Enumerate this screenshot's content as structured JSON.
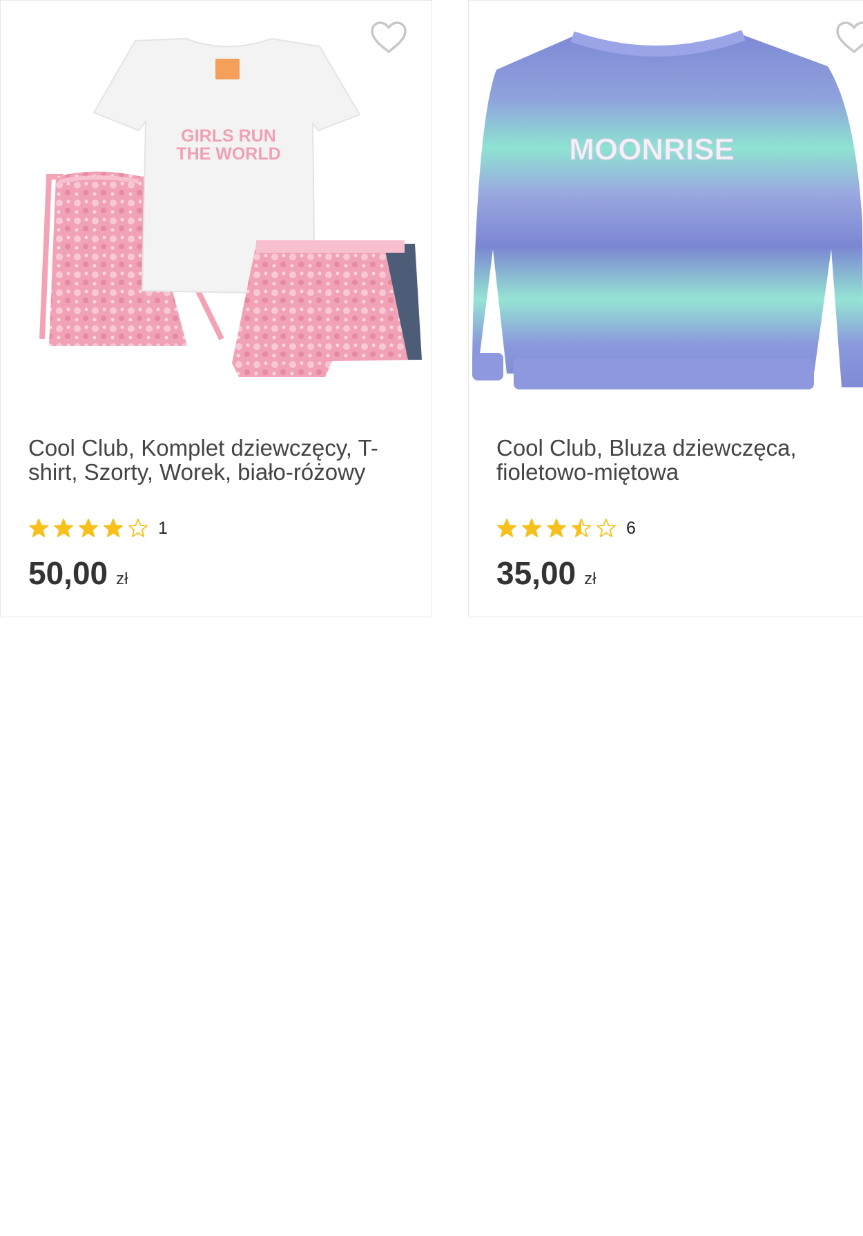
{
  "colors": {
    "star": "#f7c01b",
    "star_outline": "#999999",
    "heart_outline": "#c8c8c8",
    "title_text": "#444444",
    "price_text": "#333333",
    "card_border": "#e6e6e6"
  },
  "products": [
    {
      "title": "Cool Club, Komplet dziewczęcy, T-shirt, Szorty, Worek, biało-różowy",
      "image_text_line1": "GIRLS RUN",
      "image_text_line2": "THE WORLD",
      "rating_value": 4,
      "rating_count": "1",
      "price": "50,00",
      "currency": "zł",
      "favorite_icon": "heart-outline-icon"
    },
    {
      "title": "Cool Club, Bluza dziewczęca, fioletowo-miętowa",
      "image_text": "MOONRISE",
      "rating_value": 3.5,
      "rating_count": "6",
      "price": "35,00",
      "currency": "zł",
      "favorite_icon": "heart-outline-icon"
    }
  ]
}
